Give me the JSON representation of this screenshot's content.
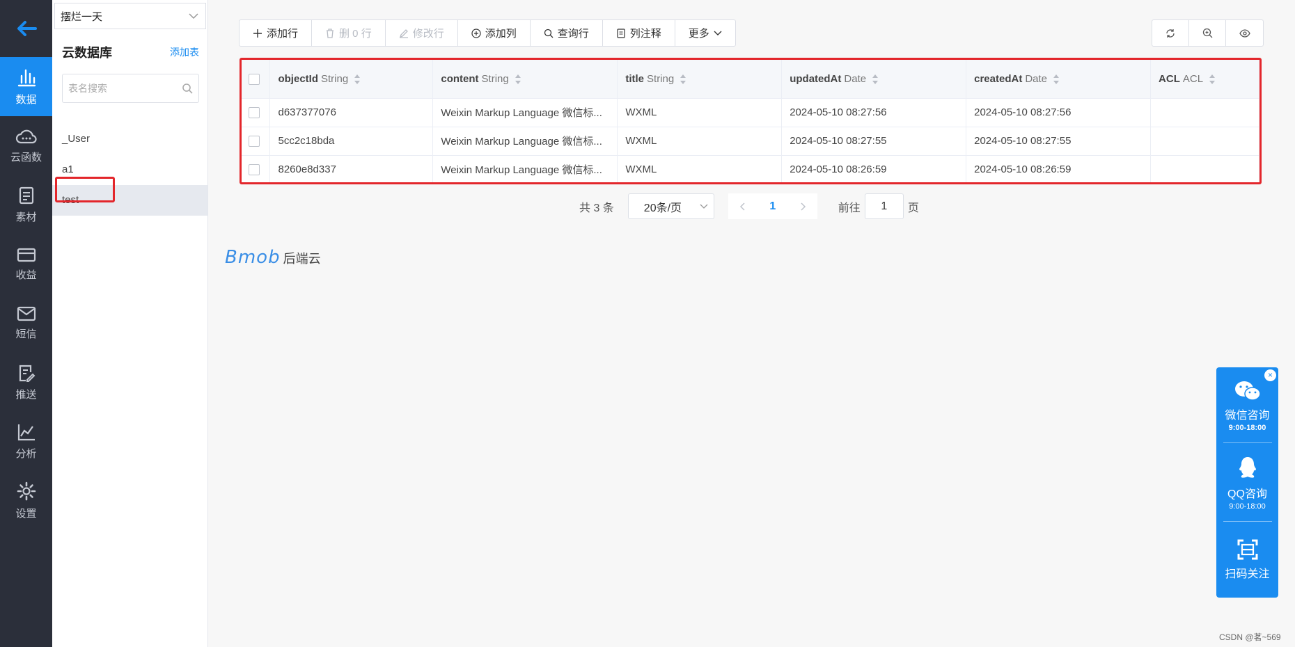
{
  "nav": {
    "items": [
      {
        "label": "数据",
        "icon": "bar-chart-icon",
        "active": true
      },
      {
        "label": "云函数",
        "icon": "cloud-icon"
      },
      {
        "label": "素材",
        "icon": "document-icon"
      },
      {
        "label": "收益",
        "icon": "card-icon"
      },
      {
        "label": "短信",
        "icon": "mail-icon"
      },
      {
        "label": "推送",
        "icon": "edit-doc-icon"
      },
      {
        "label": "分析",
        "icon": "line-chart-icon"
      },
      {
        "label": "设置",
        "icon": "gear-icon"
      }
    ]
  },
  "sidebar": {
    "app_name": "摆烂一天",
    "title": "云数据库",
    "add_table": "添加表",
    "search_placeholder": "表名搜索",
    "tables": [
      "_User",
      "a1",
      "test"
    ],
    "selected_table": "test"
  },
  "toolbar": {
    "add_row": "添加行",
    "delete_rows": "删 0 行",
    "edit_row": "修改行",
    "add_col": "添加列",
    "query_row": "查询行",
    "col_comment": "列注释",
    "more": "更多"
  },
  "table": {
    "columns": [
      {
        "name": "objectId",
        "type": "String"
      },
      {
        "name": "content",
        "type": "String"
      },
      {
        "name": "title",
        "type": "String"
      },
      {
        "name": "updatedAt",
        "type": "Date"
      },
      {
        "name": "createdAt",
        "type": "Date"
      },
      {
        "name": "ACL",
        "type": "ACL"
      }
    ],
    "rows": [
      [
        "d637377076",
        "Weixin Markup Language 微信标...",
        "WXML",
        "2024-05-10 08:27:56",
        "2024-05-10 08:27:56",
        ""
      ],
      [
        "5cc2c18bda",
        "Weixin Markup Language 微信标...",
        "WXML",
        "2024-05-10 08:27:55",
        "2024-05-10 08:27:55",
        ""
      ],
      [
        "8260e8d337",
        "Weixin Markup Language 微信标...",
        "WXML",
        "2024-05-10 08:26:59",
        "2024-05-10 08:26:59",
        ""
      ]
    ]
  },
  "pager": {
    "total": "共 3 条",
    "page_size": "20条/页",
    "current": "1",
    "goto_label": "前往",
    "goto_value": "1",
    "page_unit": "页"
  },
  "logo": {
    "brand": "Bmob",
    "suffix": "后端云"
  },
  "float": {
    "wechat": "微信咨询",
    "wechat_hours": "9:00-18:00",
    "qq": "QQ咨询",
    "qq_hours": "9:00-18:00",
    "scan": "扫码关注",
    "close": "×"
  },
  "watermark": "CSDN @茗~569",
  "colors": {
    "accent": "#1a8cf0",
    "nav_bg": "#2b2f3a",
    "highlight": "#e3262b"
  }
}
